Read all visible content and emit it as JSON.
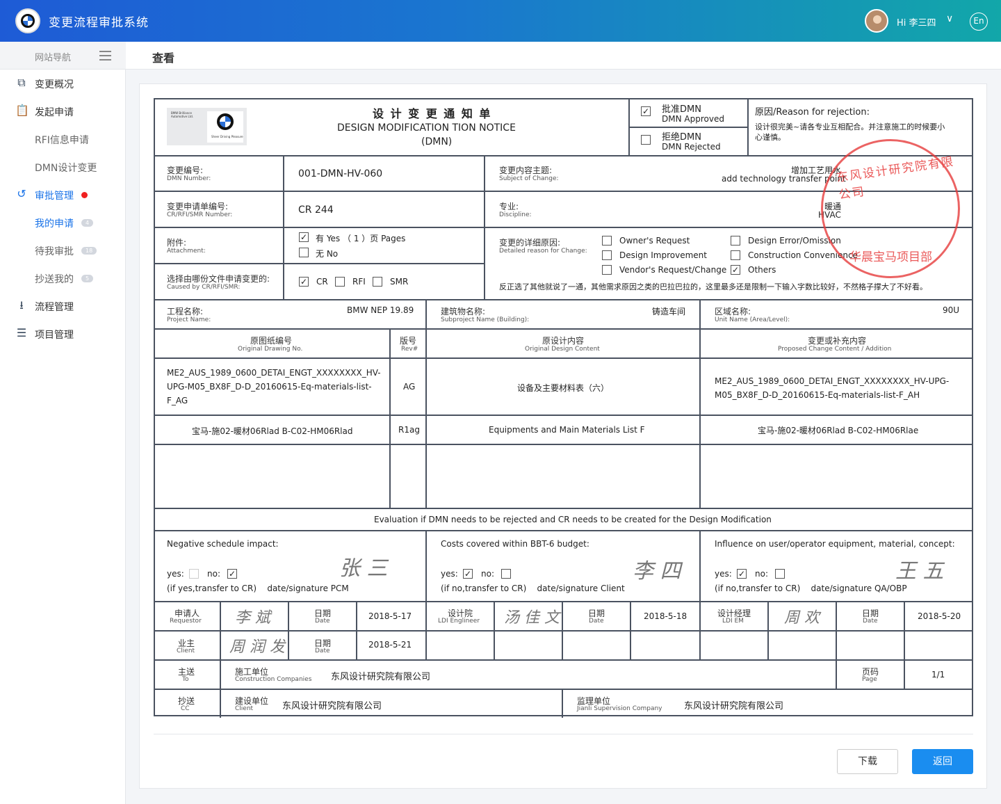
{
  "app": {
    "title": "变更流程审批系统",
    "greeting": "Hi 李三四",
    "lang": "En"
  },
  "sidebar": {
    "nav_label": "网站导航",
    "items": [
      {
        "label": "变更概况",
        "icon": "overview-icon"
      },
      {
        "label": "发起申请",
        "icon": "clipboard-icon"
      },
      {
        "label": "RFI信息申请",
        "sub": true
      },
      {
        "label": "DMN设计变更",
        "sub": true
      },
      {
        "label": "审批管理",
        "icon": "history-icon",
        "active": true
      },
      {
        "label": "我的申请",
        "sub": true,
        "badge": "4"
      },
      {
        "label": "待我审批",
        "sub": true,
        "badge": "18"
      },
      {
        "label": "抄送我的",
        "sub": true,
        "badge": "5"
      },
      {
        "label": "流程管理",
        "icon": "download-box-icon"
      },
      {
        "label": "项目管理",
        "icon": "list-icon"
      }
    ]
  },
  "page": {
    "title": "查看"
  },
  "doc": {
    "title_cn": "设 计 变 更 通 知 单",
    "title_en1": "DESIGN MODIFICATION TION NOTICE",
    "title_en2": "(DMN)",
    "approved_cn": "批准DMN",
    "approved_en": "DMN Approved",
    "rejected_cn": "拒绝DMN",
    "rejected_en": "DMN Rejected",
    "reason_label": "原因/Reason for rejection:",
    "reason_text1": "设计很完美~请各专业互相配合。并注意施工的时候要小",
    "reason_text2": "心谨慎。",
    "dmn_no_cn": "变更编号:",
    "dmn_no_en": "DMN Number:",
    "dmn_no": "001-DMN-HV-060",
    "subject_cn": "变更内容主题:",
    "subject_en": "Subject of Change:",
    "subject_v1": "增加工艺用水",
    "subject_v2": "add technology transfer point",
    "cr_no_cn": "变更申请单编号:",
    "cr_no_en": "CR/RFI/SMR Number:",
    "cr_no": "CR 244",
    "discipline_cn": "专业:",
    "discipline_en": "Discipline:",
    "discipline_v1": "暖通",
    "discipline_v2": "HVAC",
    "attach_cn": "附件:",
    "attach_en": "Attachment:",
    "attach_yes": "有 Yes （ 1 ）页 Pages",
    "attach_no": "无 No",
    "reason_detail_cn": "变更的详细原因:",
    "reason_detail_en": "Detailed reason for Change:",
    "opt1": "Owner's Request",
    "opt2": "Design Error/Omission",
    "opt3": "Design Improvement",
    "opt4": "Construction Convenience",
    "opt5": "Vendor's Request/Change",
    "opt6": "Others",
    "reason_note": "反正选了其他就说了一通，其他需求原因之类的巴拉巴拉的，这里最多还是限制一下输入字数比较好，不然格子撑大了不好看。",
    "caused_cn": "选择由哪份文件申请变更的:",
    "caused_en": "Caused by CR/RFI/SMR:",
    "cr": "CR",
    "rfi": "RFI",
    "smr": "SMR",
    "proj_cn": "工程名称:",
    "proj_en": "Project Name:",
    "proj": "BMW NEP 19.89",
    "bld_cn": "建筑物名称:",
    "bld_en": "Subproject Name (Building):",
    "bld": "铸造车间",
    "unit_cn": "区域名称:",
    "unit_en": "Unit Name (Area/Level):",
    "unit": "90U",
    "h1_cn": "原图纸编号",
    "h1_en": "Original Drawing No.",
    "h2_cn": "版号",
    "h2_en": "Rev#",
    "h3_cn": "原设计内容",
    "h3_en": "Original Design Content",
    "h4_cn": "变更或补充内容",
    "h4_en": "Proposed Change Content / Addition",
    "r1_c1a": "ME2_AUS_1989_0600_DETAI_ENGT_XXXXXXXX_HV-",
    "r1_c1b": "UPG-M05_BX8F_D-D_20160615-Eq-materials-list-",
    "r1_c1c": "F_AG",
    "r1_c2": "AG",
    "r1_c3": "设备及主要材料表（六）",
    "r1_c4a": "ME2_AUS_1989_0600_DETAI_ENGT_XXXXXXXX_HV-UPG-",
    "r1_c4b": "M05_BX8F_D-D_20160615-Eq-materials-list-F_AH",
    "r2_c1": "宝马-施02-暖材06Rlad B-C02-HM06Rlad",
    "r2_c2": "R1ag",
    "r2_c3": "Equipments and Main Materials List F",
    "r2_c4": "宝马-施02-暖材06Rlad B-C02-HM06Rlae",
    "eval": "Evaluation if DMN needs to be rejected and CR needs to be created for the Design Modification",
    "e1_t": "Negative schedule impact:",
    "e1_note": "(if yes,transfer to CR)    date/signature PCM",
    "e2_t": "Costs covered within BBT-6 budget:",
    "e2_note": "(if no,transfer to CR)    date/signature Client",
    "e3_t": "Influence on user/operator equipment, material, concept:",
    "e3_note": "(if no,transfer to CR)    date/signature QA/OBP",
    "yes": "yes:",
    "no": "no:",
    "sig1": "张 三",
    "sig2": "李 四",
    "sig3": "王 五",
    "req_cn": "申请人",
    "req_en": "Requestor",
    "req_sig": "李 斌",
    "date_cn": "日期",
    "date_en": "Date",
    "d1": "2018-5-17",
    "ldi_cn": "设计院",
    "ldi_en": "LDI Englineer",
    "ldi_sig": "汤 佳 文",
    "d2": "2018-5-18",
    "em_cn": "设计经理",
    "em_en": "LDI EM",
    "em_sig": "周 欢",
    "d3": "2018-5-20",
    "client_cn": "业主",
    "client_en": "Client",
    "client_sig": "周 润 发",
    "d4": "2018-5-21",
    "to_cn": "主送",
    "to_en": "To",
    "cc_label_cn": "施工单位",
    "cc_label_en": "Construction Companies",
    "to_company": "东风设计研究院有限公司",
    "page_cn": "页码",
    "page_en": "Page",
    "page_v": "1/1",
    "cc_cn": "抄送",
    "cc_en": "CC",
    "build_cn": "建设单位",
    "build_en": "Client",
    "build_co": "东风设计研究院有限公司",
    "sup_cn": "监理单位",
    "sup_en": "Jianli Supervision Company",
    "sup_co": "东风设计研究院有限公司",
    "stamp_top": "东风设计研究院有限公司",
    "stamp_bottom": "华晨宝马项目部",
    "logo_small": "BMW Brilliance Automotive Ltd.",
    "logo_tag": "Sheer Driving Pleasure"
  },
  "buttons": {
    "download": "下载",
    "back": "返回"
  },
  "colors": {
    "accent": "#1a8df0",
    "stamp": "#e63c3c",
    "header_start": "#1e5bd6",
    "header_end": "#12a7a9"
  }
}
